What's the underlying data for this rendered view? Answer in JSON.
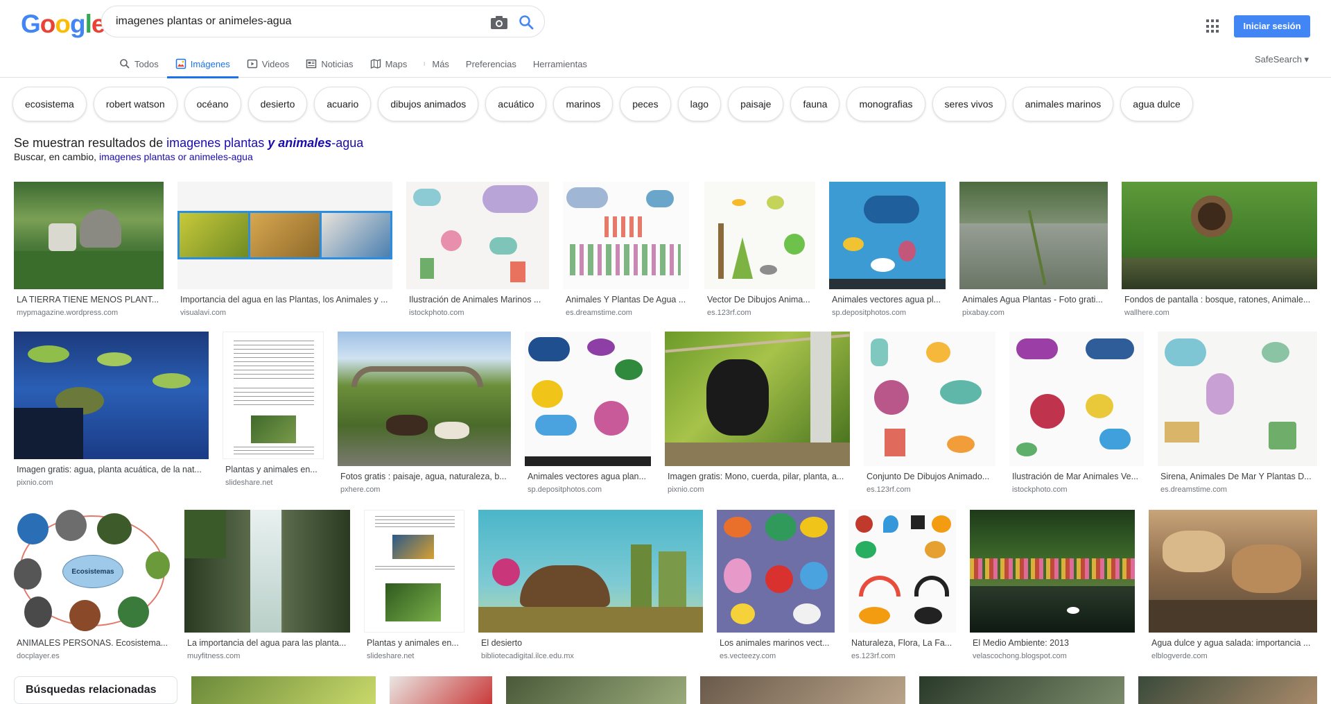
{
  "logo": [
    "G",
    "o",
    "o",
    "g",
    "l",
    "e"
  ],
  "logo_colors": [
    "#4285f4",
    "#ea4335",
    "#fbbc05",
    "#4285f4",
    "#34a853",
    "#ea4335"
  ],
  "search": {
    "value": "imagenes plantas or animeles-agua"
  },
  "header": {
    "signin_label": "Iniciar sesión",
    "safesearch": "SafeSearch ▾"
  },
  "tabs": [
    {
      "label": "Todos",
      "icon": "search-icon"
    },
    {
      "label": "Imágenes",
      "icon": "image-icon",
      "active": true
    },
    {
      "label": "Videos",
      "icon": "video-icon"
    },
    {
      "label": "Noticias",
      "icon": "news-icon"
    },
    {
      "label": "Maps",
      "icon": "map-icon"
    },
    {
      "label": "Más",
      "icon": "more-vert-icon"
    },
    {
      "label": "Preferencias"
    },
    {
      "label": "Herramientas"
    }
  ],
  "chips": [
    "ecosistema",
    "robert watson",
    "océano",
    "desierto",
    "acuario",
    "dibujos animados",
    "acuático",
    "marinos",
    "peces",
    "lago",
    "paisaje",
    "fauna",
    "monografias",
    "seres vivos",
    "animales marinos",
    "agua dulce"
  ],
  "notice": {
    "prefix": "Se muestran resultados de ",
    "link_part1": "imagenes plantas ",
    "link_bold": "y animales",
    "link_part2": "-agua",
    "instead_prefix": "Buscar, en cambio, ",
    "instead_link": "imagenes plantas or animeles-agua"
  },
  "results": [
    {
      "caption": "LA TIERRA TIENE MENOS PLANT...",
      "source": "mypmagazine.wordpress.com"
    },
    {
      "caption": "Importancia del agua en las Plantas, los Animales y ...",
      "source": "visualavi.com"
    },
    {
      "caption": "Ilustración de Animales Marinos ...",
      "source": "istockphoto.com"
    },
    {
      "caption": "Animales Y Plantas De Agua ...",
      "source": "es.dreamstime.com"
    },
    {
      "caption": "Vector De Dibujos Anima...",
      "source": "es.123rf.com"
    },
    {
      "caption": "Animales vectores agua pl...",
      "source": "sp.depositphotos.com"
    },
    {
      "caption": "Animales Agua Plantas - Foto grati...",
      "source": "pixabay.com"
    },
    {
      "caption": "Fondos de pantalla : bosque, ratones, Animale...",
      "source": "wallhere.com"
    },
    {
      "caption": "Imagen gratis: agua, planta acuática, de la nat...",
      "source": "pixnio.com"
    },
    {
      "caption": "Plantas y animales en...",
      "source": "slideshare.net"
    },
    {
      "caption": "Fotos gratis : paisaje, agua, naturaleza, b...",
      "source": "pxhere.com"
    },
    {
      "caption": "Animales vectores agua plan...",
      "source": "sp.depositphotos.com"
    },
    {
      "caption": "Imagen gratis: Mono, cuerda, pilar, planta, a...",
      "source": "pixnio.com"
    },
    {
      "caption": "Conjunto De Dibujos Animado...",
      "source": "es.123rf.com"
    },
    {
      "caption": "Ilustración de Mar Animales Ve...",
      "source": "istockphoto.com"
    },
    {
      "caption": "Sirena, Animales De Mar Y Plantas D...",
      "source": "es.dreamstime.com"
    },
    {
      "caption": "ANIMALES PERSONAS. Ecosistema...",
      "source": "docplayer.es"
    },
    {
      "caption": "La importancia del agua para las planta...",
      "source": "muyfitness.com"
    },
    {
      "caption": "Plantas y animales en...",
      "source": "slideshare.net"
    },
    {
      "caption": "El desierto",
      "source": "bibliotecadigital.ilce.edu.mx"
    },
    {
      "caption": "Los animales marinos vect...",
      "source": "es.vecteezy.com"
    },
    {
      "caption": "Naturaleza, Flora, La Fa...",
      "source": "es.123rf.com"
    },
    {
      "caption": "El Medio Ambiente: 2013",
      "source": "velascochong.blogspot.com"
    },
    {
      "caption": "Agua dulce y agua salada: importancia ...",
      "source": "elblogverde.com"
    }
  ],
  "related_label": "Búsquedas relacionadas",
  "ecosistemas_label": "Ecosistemas"
}
